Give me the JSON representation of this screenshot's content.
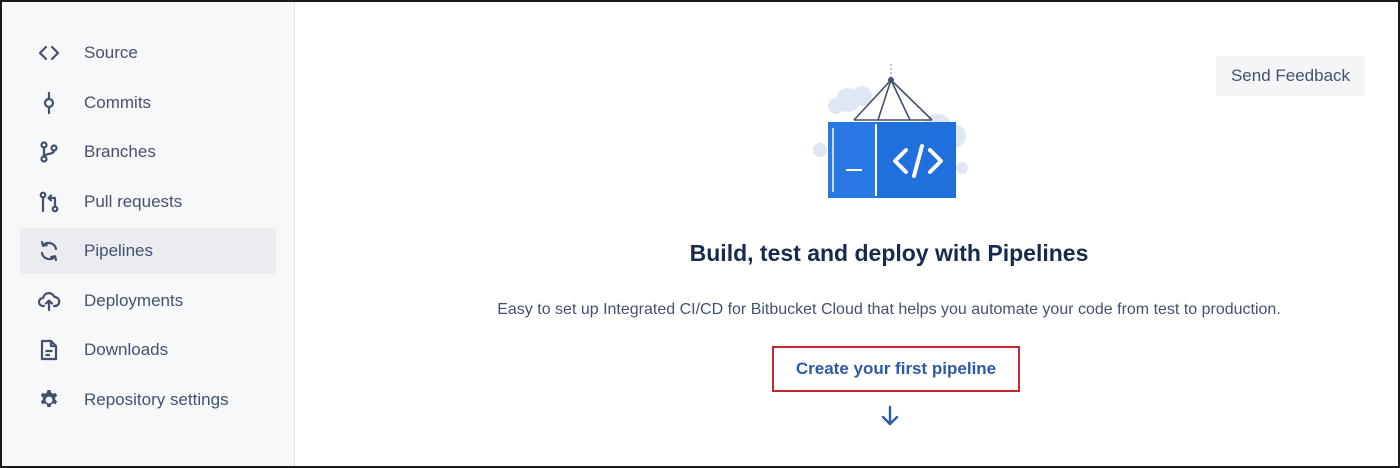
{
  "sidebar": {
    "items": [
      {
        "label": "Source",
        "icon": "code-brackets-icon"
      },
      {
        "label": "Commits",
        "icon": "commit-icon"
      },
      {
        "label": "Branches",
        "icon": "branch-icon"
      },
      {
        "label": "Pull requests",
        "icon": "pull-request-icon"
      },
      {
        "label": "Pipelines",
        "icon": "pipelines-icon",
        "active": true
      },
      {
        "label": "Deployments",
        "icon": "cloud-upload-icon"
      },
      {
        "label": "Downloads",
        "icon": "document-icon"
      },
      {
        "label": "Repository settings",
        "icon": "gear-icon"
      }
    ]
  },
  "main": {
    "feedback_label": "Send Feedback",
    "headline": "Build, test and deploy with Pipelines",
    "subtext": "Easy to set up Integrated CI/CD for Bitbucket Cloud that helps you automate your code from test to production.",
    "cta_label": "Create your first pipeline",
    "illustration_icon": "container-code-icon",
    "arrow_icon": "arrow-down-icon"
  },
  "colors": {
    "accent": "#2d5aa8",
    "illustration_blue": "#1f6fdc",
    "highlight_border": "#c0282d",
    "sidebar_bg": "#f7f8f9",
    "active_bg": "#ebecf0"
  }
}
